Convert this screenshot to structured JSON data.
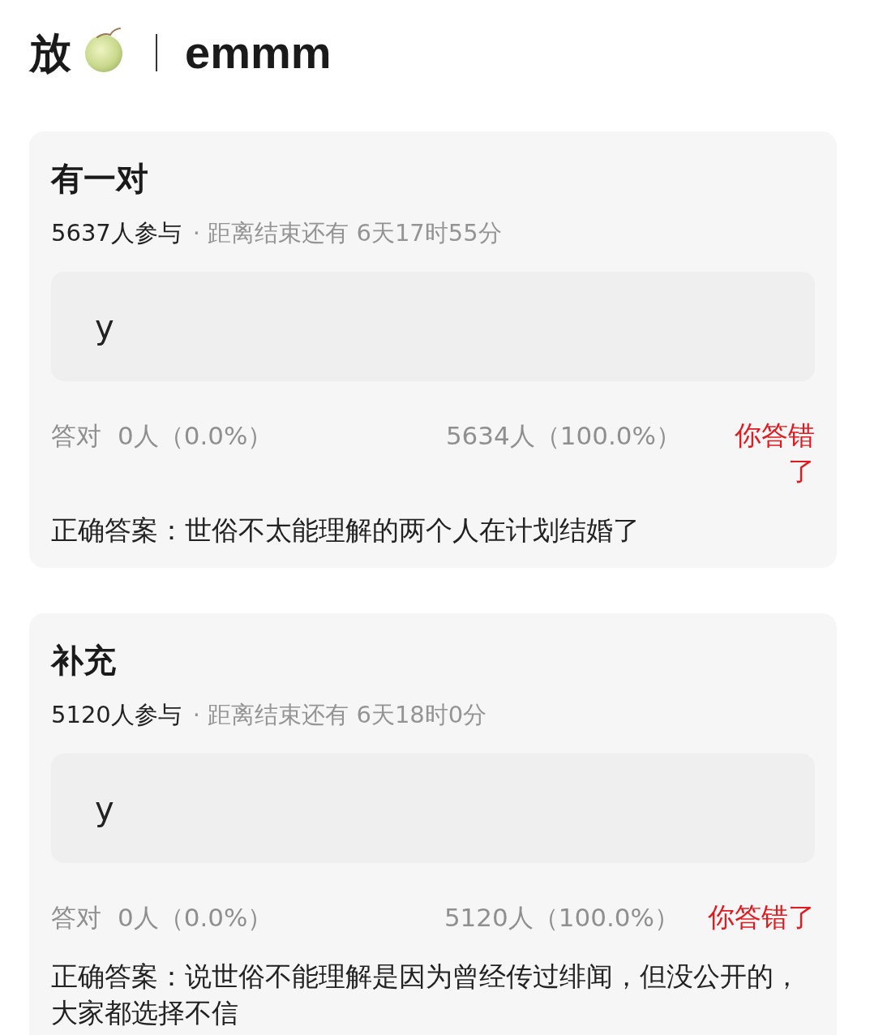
{
  "header": {
    "title": "放",
    "subtitle": "emmm"
  },
  "polls": [
    {
      "title": "有一对",
      "participants": "5637人参与",
      "deadline": "· 距离结束还有 6天17时55分",
      "option": "y",
      "correct_label": "答对",
      "correct_count": "0人（0.0%）",
      "other_count": "5634人（100.0%）",
      "verdict": "你答错了",
      "answer": "正确答案：世俗不太能理解的两个人在计划结婚了"
    },
    {
      "title": "补充",
      "participants": "5120人参与",
      "deadline": "· 距离结束还有 6天18时0分",
      "option": "y",
      "correct_label": "答对",
      "correct_count": "0人（0.0%）",
      "other_count": "5120人（100.0%）",
      "verdict": "你答错了",
      "answer": "正确答案：说世俗不能理解是因为曾经传过绯闻，但没公开的，大家都选择不信"
    }
  ]
}
